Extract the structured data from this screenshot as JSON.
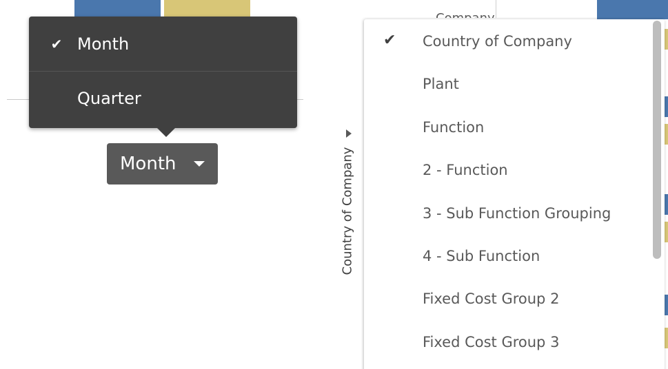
{
  "colors": {
    "bar_blue": "#4a77ad",
    "bar_yellow": "#d8c677",
    "menu_dark": "#404040",
    "button_dark": "#595959"
  },
  "period_menu": {
    "items": [
      {
        "label": "Month",
        "selected": true,
        "icon": "check-icon"
      },
      {
        "label": "Quarter",
        "selected": false
      }
    ]
  },
  "period_button": {
    "label": "Month",
    "icon": "caret-down-icon"
  },
  "dimension": {
    "label": "Country of Company",
    "icon": "expand-arrow-icon"
  },
  "partial_header": {
    "text": "Company"
  },
  "field_menu": {
    "items": [
      {
        "label": "Country of Company",
        "selected": true,
        "icon": "check-icon"
      },
      {
        "label": "Plant",
        "selected": false
      },
      {
        "label": "Function",
        "selected": false
      },
      {
        "label": "2 - Function",
        "selected": false
      },
      {
        "label": "3 - Sub Function Grouping",
        "selected": false
      },
      {
        "label": "4 - Sub Function",
        "selected": false
      },
      {
        "label": "Fixed Cost Group 2",
        "selected": false
      },
      {
        "label": "Fixed Cost Group 3",
        "selected": false
      }
    ]
  }
}
